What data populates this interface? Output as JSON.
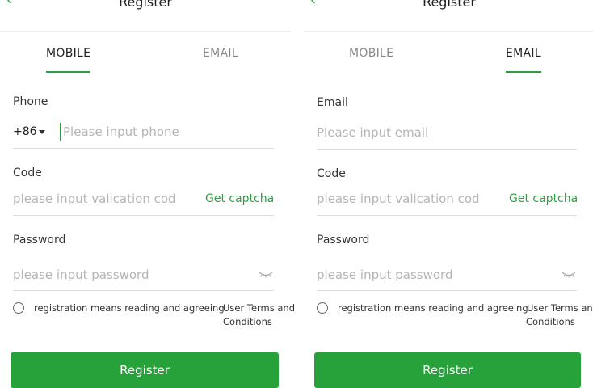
{
  "mobile_form": {
    "title": "Register",
    "tabs": {
      "mobile": "MOBILE",
      "email": "EMAIL"
    },
    "phone_label": "Phone",
    "country_code": "+86",
    "phone_placeholder": "Please input phone",
    "code_label": "Code",
    "code_placeholder": "please input valication cod",
    "captcha_label": "Get captcha",
    "password_label": "Password",
    "password_placeholder": "please input password",
    "agree_text": "registration means reading and agreeing",
    "terms_line1": "User Terms and",
    "terms_line2": "Conditions",
    "register_label": "Register"
  },
  "email_form": {
    "title": "Register",
    "tabs": {
      "mobile": "MOBILE",
      "email": "EMAIL"
    },
    "email_label": "Email",
    "email_placeholder": "Please input email",
    "code_label": "Code",
    "code_placeholder": "please input valication cod",
    "captcha_label": "Get captcha",
    "password_label": "Password",
    "password_placeholder": "please input password",
    "agree_text": "registration means reading and agreeing",
    "terms_line1": "User Terms and",
    "terms_line2": "Conditions",
    "register_label": "Register"
  },
  "theme": {
    "accent": "#2e9e44",
    "button": "#27a23a"
  },
  "icons": {
    "back": "chevron-left-icon",
    "dropdown": "caret-down-icon",
    "eye": "eye-closed-icon",
    "agree": "radio-circle-icon"
  }
}
